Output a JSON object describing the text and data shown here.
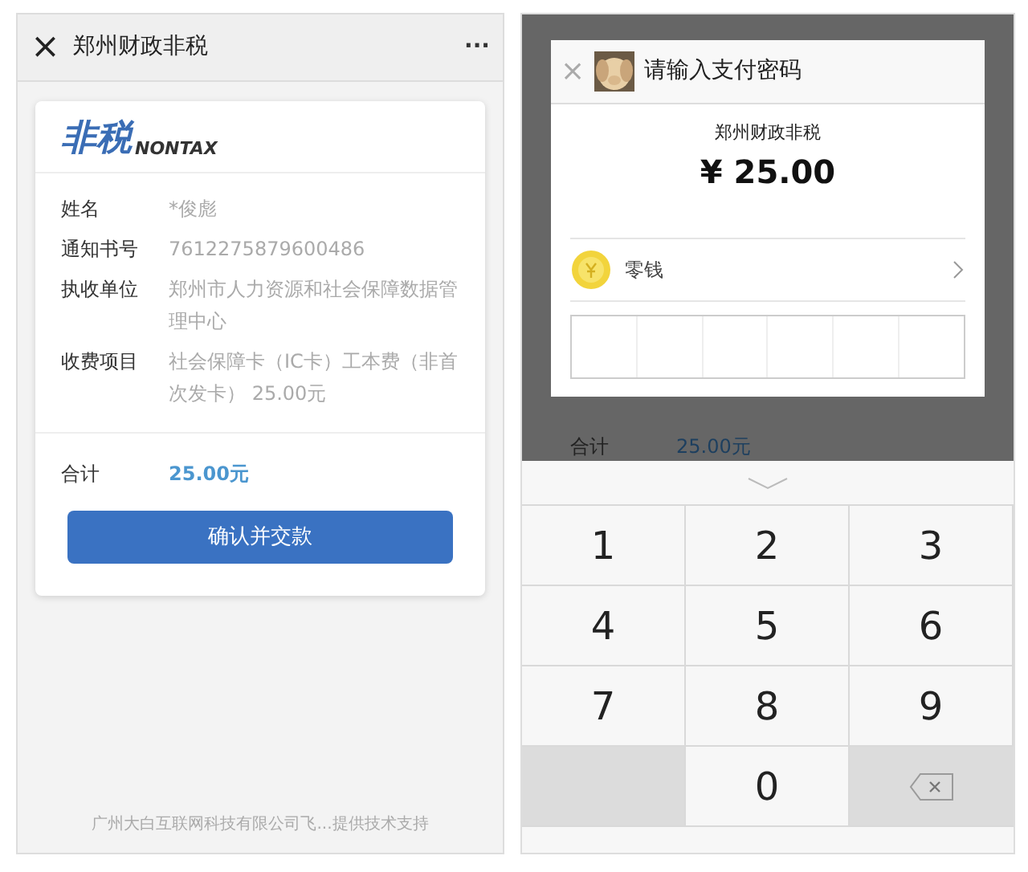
{
  "left_screen": {
    "header": {
      "close": "×",
      "title": "郑州财政非税",
      "more": "···"
    },
    "logo": {
      "mark": "非税",
      "text": "NONTAX"
    },
    "fields": [
      {
        "label": "姓名",
        "value": "*俊彪"
      },
      {
        "label": "通知书号",
        "value": "7612275879600486"
      },
      {
        "label": "执收单位",
        "value": "郑州市人力资源和社会保障数据管理中心"
      },
      {
        "label": "收费项目",
        "value": "社会保障卡（IC卡）工本费（非首次发卡） 25.00元"
      }
    ],
    "total": {
      "label": "合计",
      "value": "25.00元"
    },
    "confirm_button": "确认并交款",
    "footer": "广州大白互联网科技有限公司飞...提供技术支持"
  },
  "right_screen": {
    "background_total": {
      "label": "合计",
      "value": "25.00元"
    },
    "dialog": {
      "close": "×",
      "title": "请输入支付密码",
      "payee": "郑州财政非税",
      "amount": "¥ 25.00",
      "method": "零钱"
    },
    "keypad": [
      {
        "kind": "digit",
        "label": "1"
      },
      {
        "kind": "digit",
        "label": "2"
      },
      {
        "kind": "digit",
        "label": "3"
      },
      {
        "kind": "digit",
        "label": "4"
      },
      {
        "kind": "digit",
        "label": "5"
      },
      {
        "kind": "digit",
        "label": "6"
      },
      {
        "kind": "digit",
        "label": "7"
      },
      {
        "kind": "digit",
        "label": "8"
      },
      {
        "kind": "digit",
        "label": "9"
      },
      {
        "kind": "blank"
      },
      {
        "kind": "digit",
        "label": "0"
      },
      {
        "kind": "backspace"
      }
    ]
  }
}
